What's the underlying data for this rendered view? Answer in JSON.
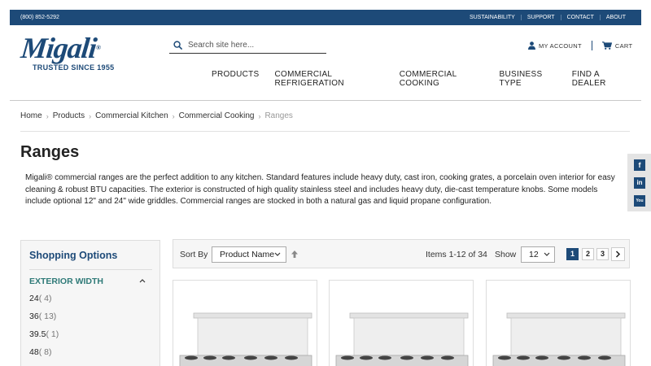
{
  "topbar": {
    "phone": "(800) 852-5292",
    "links": [
      "SUSTAINABILITY",
      "SUPPORT",
      "CONTACT",
      "ABOUT"
    ]
  },
  "logo": {
    "wordmark": "Migali",
    "registered": "®",
    "tagline": "TRUSTED SINCE 1955"
  },
  "search": {
    "placeholder": "Search site here..."
  },
  "account": {
    "my_account": "MY ACCOUNT",
    "cart": "CART"
  },
  "nav": [
    "PRODUCTS",
    "COMMERCIAL REFRIGERATION",
    "COMMERCIAL COOKING",
    "BUSINESS TYPE",
    "FIND A DEALER"
  ],
  "breadcrumb": [
    "Home",
    "Products",
    "Commercial Kitchen",
    "Commercial Cooking"
  ],
  "breadcrumb_current": "Ranges",
  "page_title": "Ranges",
  "description": "Migali® commercial ranges are the perfect addition to any kitchen. Standard features include heavy duty, cast iron, cooking grates, a porcelain oven interior for easy cleaning & robust BTU capacities.  The exterior is constructed of high quality stainless steel and includes heavy duty, die-cast temperature knobs. Some models include optional 12\" and 24\" wide griddles. Commercial ranges are stocked in both a natural gas and liquid propane configuration.",
  "social": [
    "f",
    "in",
    "You"
  ],
  "sidebar": {
    "title": "Shopping Options",
    "filter_title": "EXTERIOR WIDTH",
    "options": [
      {
        "label": "24",
        "count": "( 4)"
      },
      {
        "label": "36",
        "count": "( 13)"
      },
      {
        "label": "39.5",
        "count": "( 1)"
      },
      {
        "label": "48",
        "count": "( 8)"
      }
    ]
  },
  "toolbar": {
    "sort_label": "Sort By",
    "sort_value": "Product Name",
    "items_text": "Items 1-12 of 34",
    "show_label": "Show",
    "show_value": "12",
    "pages": [
      "1",
      "2",
      "3"
    ]
  },
  "colors": {
    "brand": "#1d4a78",
    "filter": "#2f7a78"
  }
}
